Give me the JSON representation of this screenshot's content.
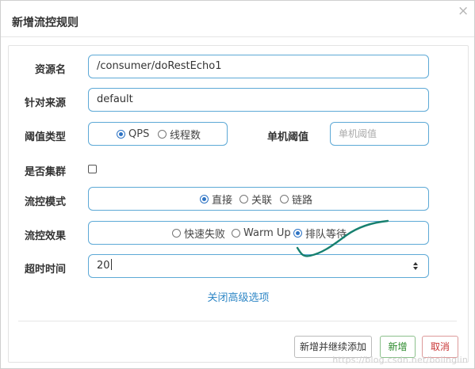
{
  "dialog": {
    "title": "新增流控规则",
    "close_glyph": "×"
  },
  "form": {
    "resource": {
      "label": "资源名",
      "value": "/consumer/doRestEcho1"
    },
    "origin": {
      "label": "针对来源",
      "value": "default"
    },
    "threshold_type": {
      "label": "阈值类型",
      "options": [
        {
          "label": "QPS",
          "selected": true
        },
        {
          "label": "线程数",
          "selected": false
        }
      ]
    },
    "single_threshold": {
      "label": "单机阈值",
      "placeholder": "单机阈值"
    },
    "cluster": {
      "label": "是否集群",
      "checked": false
    },
    "flow_mode": {
      "label": "流控模式",
      "options": [
        {
          "label": "直接",
          "selected": true
        },
        {
          "label": "关联",
          "selected": false
        },
        {
          "label": "链路",
          "selected": false
        }
      ]
    },
    "flow_effect": {
      "label": "流控效果",
      "options": [
        {
          "label": "快速失败",
          "selected": false
        },
        {
          "label": "Warm Up",
          "selected": false
        },
        {
          "label": "排队等待",
          "selected": true
        }
      ]
    },
    "timeout": {
      "label": "超时时间",
      "value": "20"
    },
    "advanced_link": "关闭高级选项"
  },
  "footer": {
    "save_continue_label": "新增并继续添加",
    "add_label": "新增",
    "cancel_label": "取消"
  },
  "watermark": "https://blog.csdn.net/bolinglin",
  "colors": {
    "accent_border": "#5da9d6",
    "link": "#2f87c6",
    "add": "#2b8a2b",
    "cancel": "#c93535",
    "annotation_stroke": "#17806f"
  }
}
